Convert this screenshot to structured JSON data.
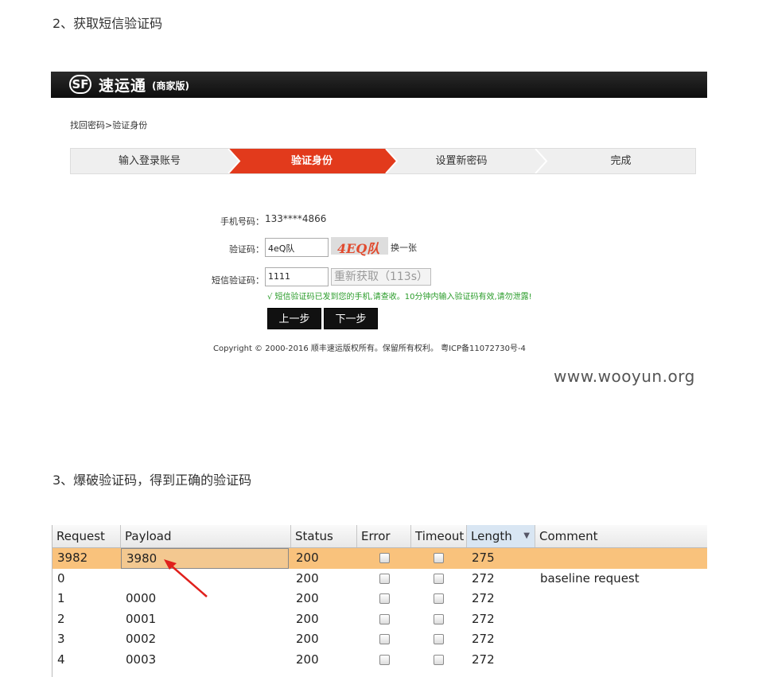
{
  "headings": {
    "step2": "2、获取短信验证码",
    "step3": "3、爆破验证码，得到正确的验证码"
  },
  "sf": {
    "logo_mark": "SF",
    "logo_text": "速运通",
    "logo_sub": "(商家版)",
    "breadcrumb": "找回密码>验证身份",
    "steps": [
      "输入登录账号",
      "验证身份",
      "设置新密码",
      "完成"
    ],
    "active_step_index": 1,
    "phone_label": "手机号码：",
    "phone_value": "133****4866",
    "captcha_label": "验证码：",
    "captcha_value": "4eQ队",
    "captcha_image_text": "4EQ队",
    "captcha_change": "换一张",
    "sms_label": "短信验证码：",
    "sms_value": "1111",
    "resend_label": "重新获取（113s）",
    "hint": "√ 短信验证码已发到您的手机,请查收。10分钟内输入验证码有效,请勿泄露!",
    "prev_button": "上一步",
    "next_button": "下一步",
    "copyright": "Copyright © 2000-2016 顺丰速运版权所有。保留所有权利。 粤ICP备11072730号-4",
    "colors": {
      "active_step": "#e23a1c",
      "topbar": "#141414",
      "hint": "#2a9c2a"
    }
  },
  "watermark": "www.wooyun.org",
  "results": {
    "columns": [
      "Request",
      "Payload",
      "Status",
      "Error",
      "Timeout",
      "Length",
      "Comment"
    ],
    "sorted_column": "Length",
    "highlight_color": "#f9c27c",
    "rows": [
      {
        "request": "3982",
        "payload": "3980",
        "status": "200",
        "length": "275",
        "comment": "",
        "highlighted": true
      },
      {
        "request": "0",
        "payload": "",
        "status": "200",
        "length": "272",
        "comment": "baseline request",
        "highlighted": false
      },
      {
        "request": "1",
        "payload": "0000",
        "status": "200",
        "length": "272",
        "comment": "",
        "highlighted": false
      },
      {
        "request": "2",
        "payload": "0001",
        "status": "200",
        "length": "272",
        "comment": "",
        "highlighted": false
      },
      {
        "request": "3",
        "payload": "0002",
        "status": "200",
        "length": "272",
        "comment": "",
        "highlighted": false
      },
      {
        "request": "4",
        "payload": "0003",
        "status": "200",
        "length": "272",
        "comment": "",
        "highlighted": false
      }
    ]
  }
}
